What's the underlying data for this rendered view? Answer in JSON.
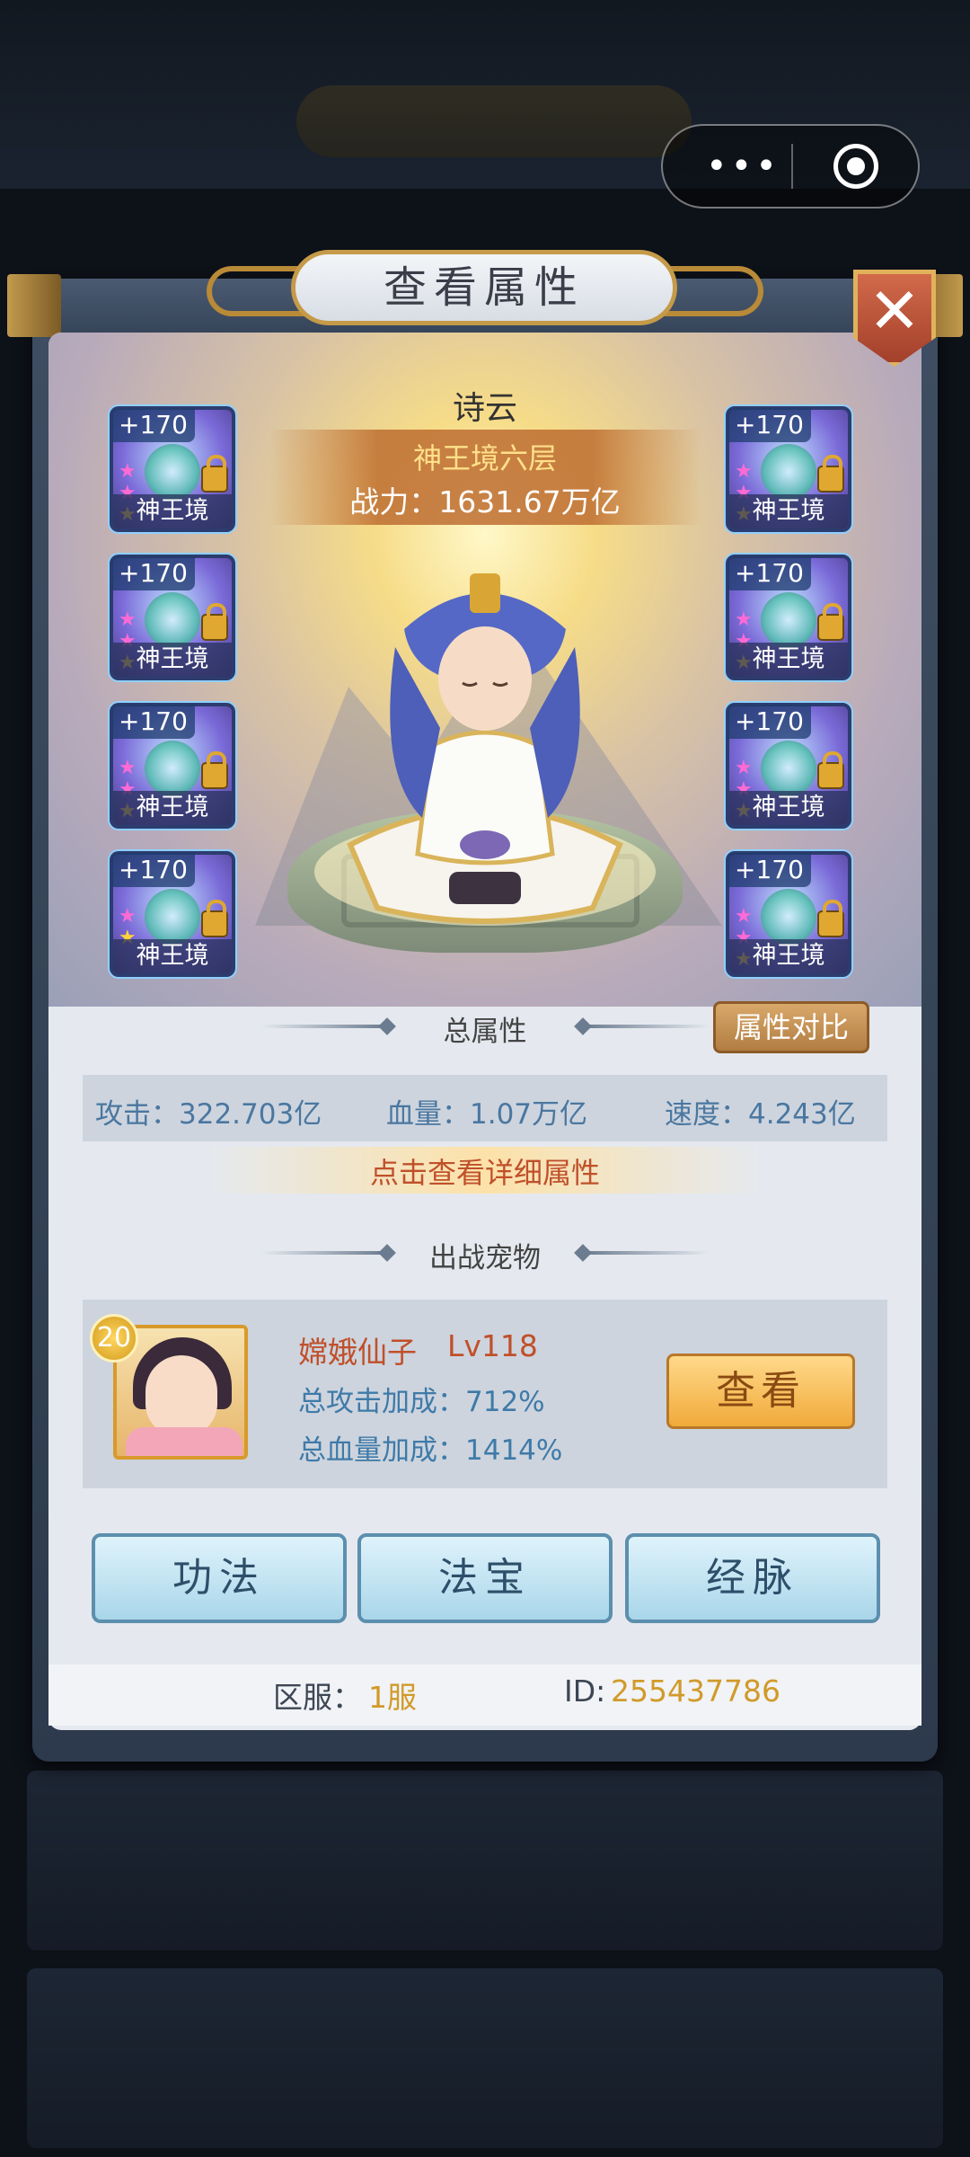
{
  "capsule": {
    "more_glyph": "•••",
    "more_icon": "more-dots-icon",
    "target_icon": "target-icon"
  },
  "dialog": {
    "title": "查看属性",
    "close_glyph": "✕"
  },
  "hero": {
    "name": "诗云",
    "realm": "神王境六层",
    "power": "战力：1631.67万亿"
  },
  "equipment": {
    "left": [
      {
        "plus": "+170",
        "label": "神王境",
        "pink_stars": 2,
        "gold_stars": 1
      },
      {
        "plus": "+170",
        "label": "神王境",
        "pink_stars": 2,
        "gold_stars": 1
      },
      {
        "plus": "+170",
        "label": "神王境",
        "pink_stars": 2,
        "gold_stars": 1
      },
      {
        "plus": "+170",
        "label": "神王境",
        "pink_stars": 1,
        "gold_stars": 1
      }
    ],
    "right": [
      {
        "plus": "+170",
        "label": "神王境",
        "pink_stars": 2,
        "gold_stars": 1
      },
      {
        "plus": "+170",
        "label": "神王境",
        "pink_stars": 2,
        "gold_stars": 1
      },
      {
        "plus": "+170",
        "label": "神王境",
        "pink_stars": 2,
        "gold_stars": 1
      },
      {
        "plus": "+170",
        "label": "神王境",
        "pink_stars": 2,
        "gold_stars": 1
      }
    ]
  },
  "attributes": {
    "section_title": "总属性",
    "compare_button": "属性对比",
    "attack": "攻击：322.703亿",
    "hp": "血量：1.07万亿",
    "speed": "速度：4.243亿",
    "detail_link": "点击查看详细属性"
  },
  "pet": {
    "section_title": "出战宠物",
    "level_badge": "20",
    "name": "嫦娥仙子",
    "lv": "Lv118",
    "attack_bonus": "总攻击加成：712%",
    "hp_bonus": "总血量加成：1414%",
    "view_button": "查看"
  },
  "buttons": {
    "gongfa": "功法",
    "fabao": "法宝",
    "jingmai": "经脉"
  },
  "footer": {
    "server_label": "区服：",
    "server_value": "1服",
    "id_label": "ID:",
    "id_value": "255437786"
  },
  "colors": {
    "accent_gold": "#c59a48",
    "stat_blue": "#4a77a0",
    "link_red": "#c0502a"
  }
}
